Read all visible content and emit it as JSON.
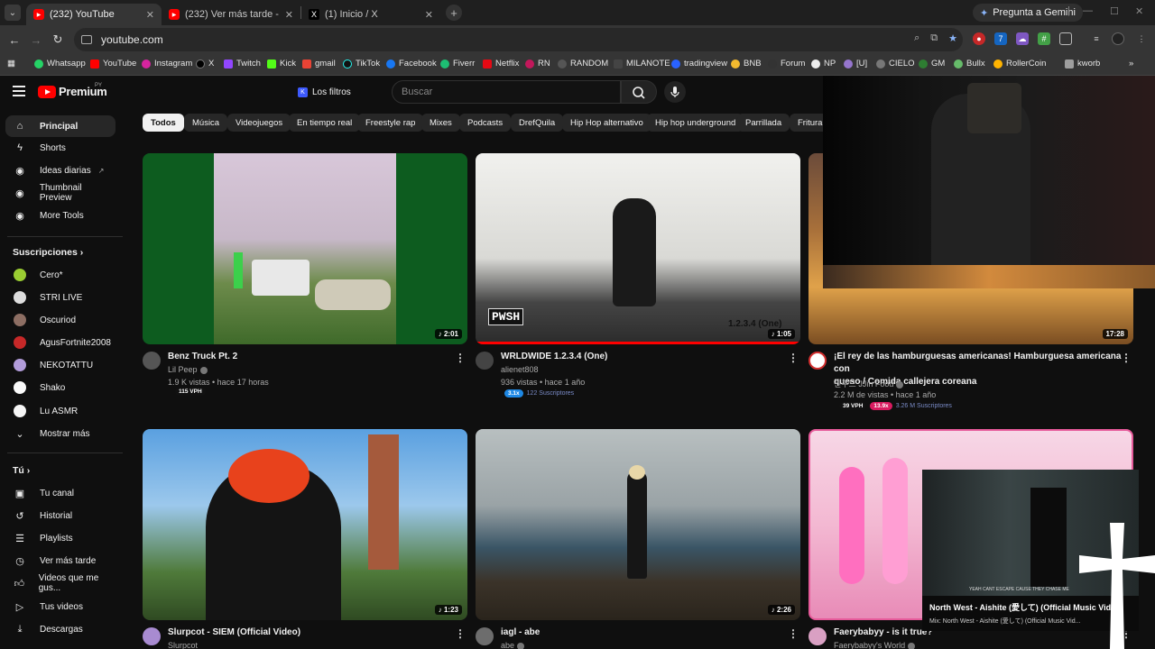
{
  "browser": {
    "tabs": [
      {
        "title": "(232) YouTube",
        "active": true
      },
      {
        "title": "(232) Ver más tarde - YouTube",
        "active": false
      },
      {
        "title": "(1) Inicio / X",
        "active": false
      }
    ],
    "gemini_label": "Pregunta a Gemini",
    "url": "youtube.com",
    "bookmarks": [
      "Whatsapp",
      "YouTube",
      "Instagram",
      "X",
      "Twitch",
      "Kick",
      "gmail",
      "TikTok",
      "Facebook",
      "Fiverr",
      "Netflix",
      "RN",
      "RANDOM",
      "MILANOTE",
      "tradingview",
      "BNB",
      "Forum",
      "NP",
      "[U]",
      "CIELO",
      "GM",
      "Bullx",
      "RollerCoin",
      "kworb"
    ],
    "bookmarks_overflow": "»"
  },
  "yt": {
    "logo_text": "Premium",
    "logo_country": "PY",
    "filters_label": "Los filtros",
    "search_placeholder": "Buscar",
    "sidebar": {
      "main": [
        "Principal",
        "Shorts",
        "Ideas diarias",
        "Thumbnail Preview",
        "More Tools"
      ],
      "subs_header": "Suscripciones",
      "subs": [
        "Cero*",
        "STRI LIVE",
        "Oscuriod",
        "AgusFortnite2008",
        "NEKOTATTU",
        "Shako",
        "Lu ASMR"
      ],
      "show_more": "Mostrar más",
      "you_header": "Tú",
      "you": [
        "Tu canal",
        "Historial",
        "Playlists",
        "Ver más tarde",
        "Videos que me gus...",
        "Tus videos",
        "Descargas"
      ]
    },
    "chips": [
      "Todos",
      "Música",
      "Videojuegos",
      "En tiempo real",
      "Freestyle rap",
      "Mixes",
      "Podcasts",
      "DrefQuila",
      "Hip Hop alternativo",
      "Hip hop underground",
      "Parrillada",
      "Fritura"
    ],
    "videos": [
      {
        "title": "Benz Truck Pt. 2",
        "channel": "Lil Peep",
        "meta": "1.9 K vistas • hace 17 horas",
        "duration": "2:01",
        "vph": "115 VPH"
      },
      {
        "title": "WRLDWIDE 1.2.3.4 (One)",
        "channel": "alienet808",
        "meta": "936 vistas • hace 1 año",
        "duration": "1:05",
        "ratio": "3.1x",
        "subs": "122 Suscriptores",
        "overlay_text": "PWSH",
        "overlay_text2": "1.2.3.4 (One)"
      },
      {
        "title_l1": "¡El rey de las hamburguesas americanas! Hamburguesa americana con",
        "title_l2": "queso / Comida callejera coreana",
        "channel": "찐푸드 JJin Food",
        "meta": "2.2 M de vistas • hace 1 año",
        "duration": "17:28",
        "vph": "39 VPH",
        "ratio": "13.9x",
        "subs": "3.26 M Suscriptores"
      },
      {
        "title": "Slurpcot - SIEM (Official Video)",
        "channel": "Slurpcot",
        "duration": "1:23"
      },
      {
        "title": "iagl - abe",
        "channel": "abe",
        "duration": "2:26"
      },
      {
        "title": "Faerybabyy - is it true?",
        "channel": "Faerybabyy's World"
      }
    ],
    "miniplayer": {
      "title": "North West - Aishite (愛して) (Official Music Vid...",
      "subtitle": "Mix: North West - Aishite (愛して) (Official Music Vid...",
      "caption": "YEAH CANT ESCAPE CAUSE THEY CHASE ME"
    }
  }
}
